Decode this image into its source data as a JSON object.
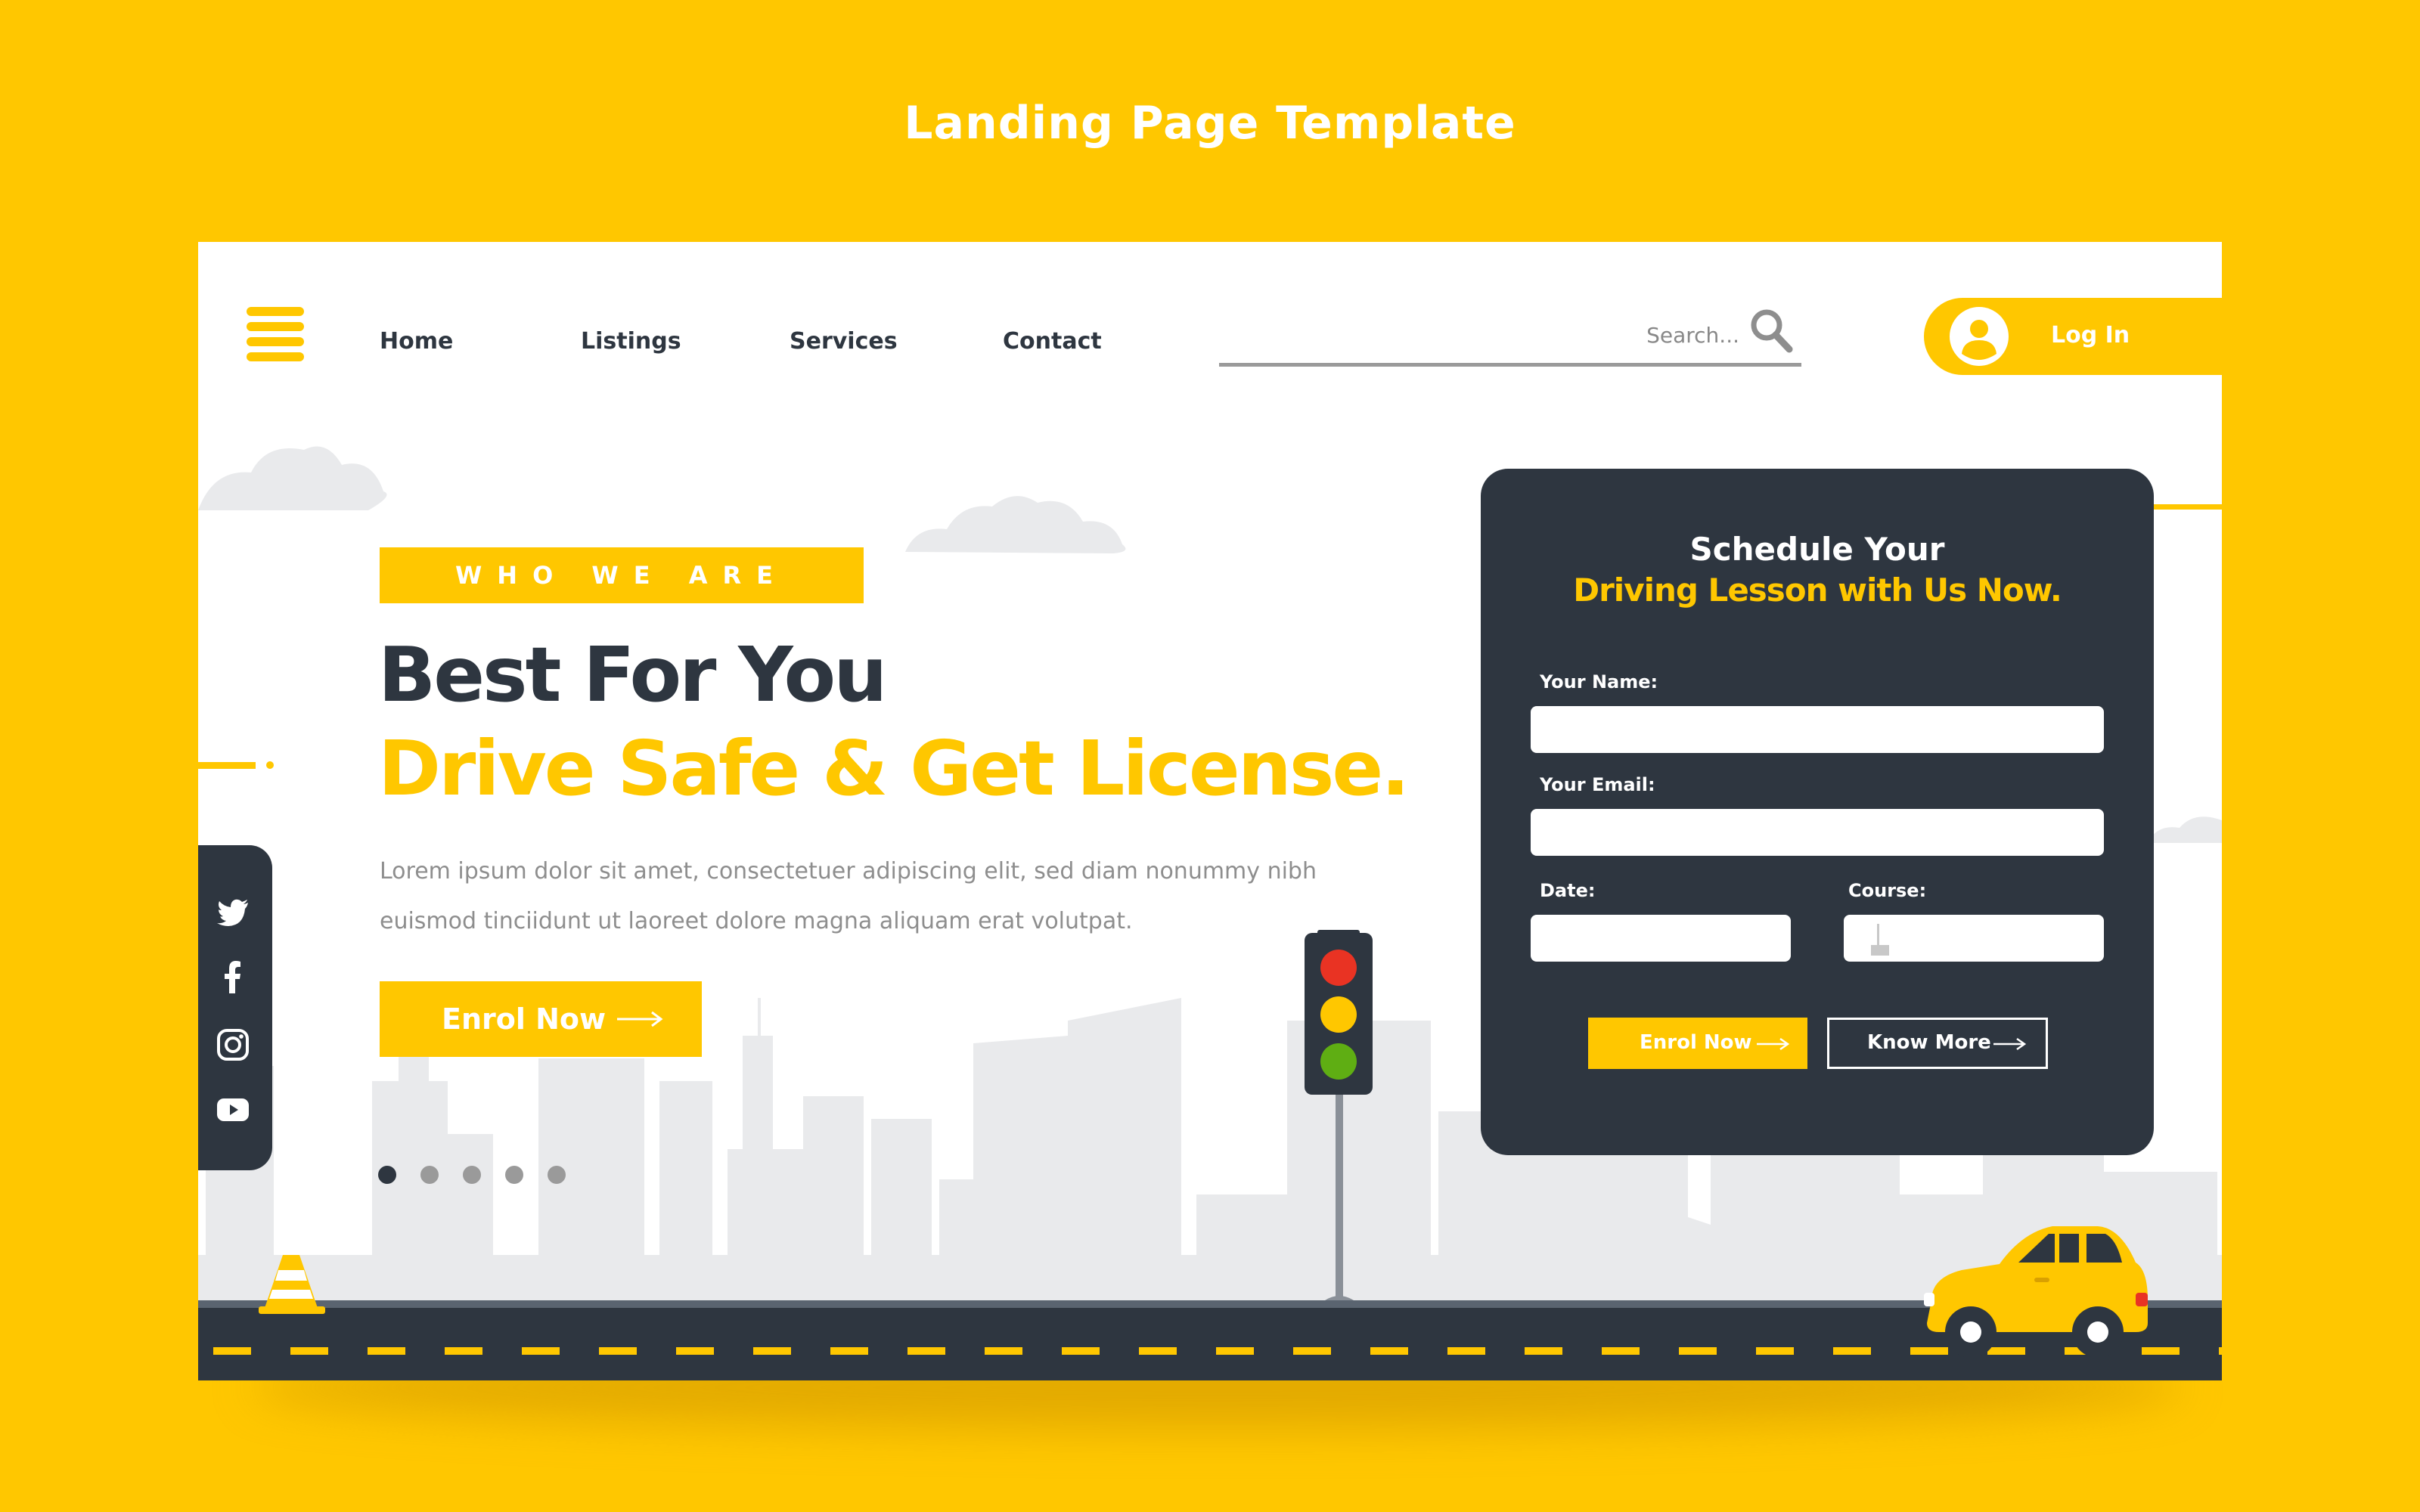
{
  "page": {
    "title": "Landing Page Template"
  },
  "header": {
    "nav": [
      "Home",
      "Listings",
      "Services",
      "Contact"
    ],
    "search_placeholder": "Search...",
    "login_label": "Log In"
  },
  "hero": {
    "eyebrow": "WHO WE ARE",
    "headline": "Best For You",
    "subheadline": "Drive Safe & Get License.",
    "body_line1": "Lorem ipsum dolor sit amet, consectetuer adipiscing elit, sed diam nonummy nibh",
    "body_line2": "euismod tinciidunt ut laoreet dolore magna aliquam erat volutpat.",
    "cta_label": "Enrol Now",
    "carousel": {
      "count": 5,
      "active": 1
    }
  },
  "social": [
    "twitter-icon",
    "facebook-icon",
    "instagram-icon",
    "youtube-icon"
  ],
  "form": {
    "title": "Schedule Your",
    "subtitle": "Driving Lesson with Us Now.",
    "name_label": "Your Name:",
    "email_label": "Your Email:",
    "date_label": "Date:",
    "course_label": "Course:",
    "enrol_label": "Enrol Now",
    "know_more_label": "Know More"
  },
  "colors": {
    "brand_yellow": "#FFC700",
    "dark": "#2E3640",
    "text_gray": "#8E8E8E",
    "skyline_gray": "#EBEBEB"
  }
}
